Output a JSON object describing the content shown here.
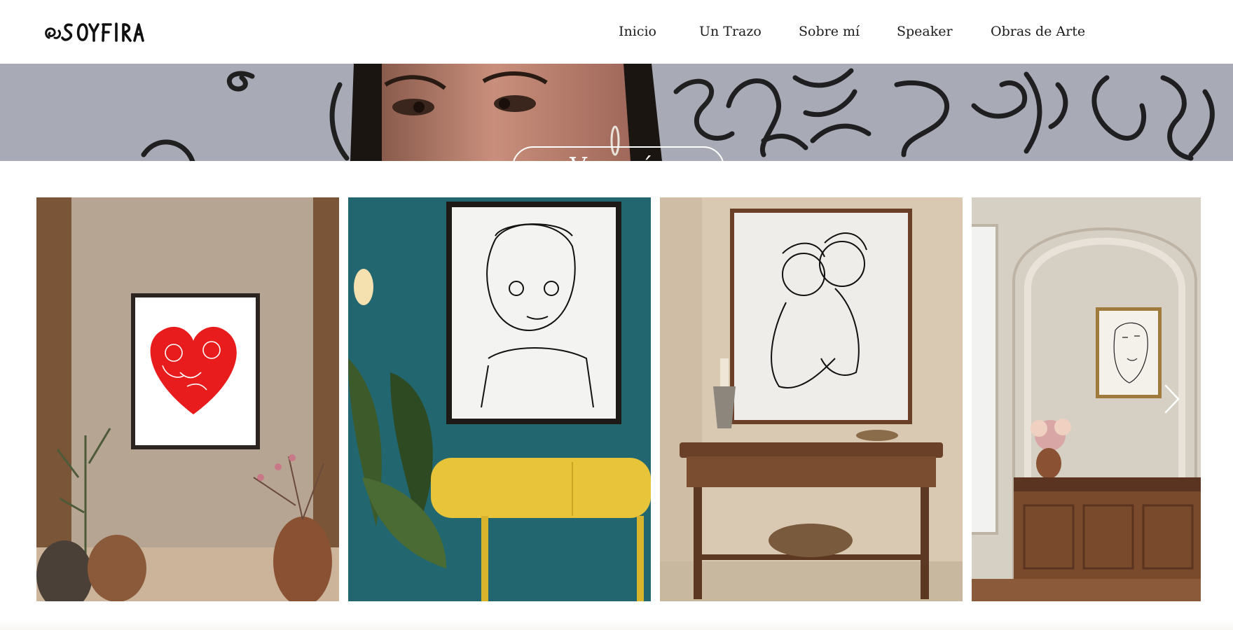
{
  "brand": {
    "logo_text": "SOYFIRA"
  },
  "nav": {
    "items": [
      {
        "label": "Inicio"
      },
      {
        "label": "Un Trazo"
      },
      {
        "label": "Sobre mí"
      },
      {
        "label": "Speaker"
      },
      {
        "label": "Obras de Arte"
      }
    ]
  },
  "hero": {
    "cta_label": "Ver más"
  },
  "gallery": {
    "items": [
      {
        "title": "heart-artwork"
      },
      {
        "title": "portrait-artwork"
      },
      {
        "title": "couple-artwork"
      },
      {
        "title": "face-artwork"
      }
    ],
    "next_icon": "chevron-right-icon"
  },
  "colors": {
    "heart_red": "#e81c1c",
    "teal_wall": "#1f5f66",
    "yellow_table": "#e8c43a",
    "beige_wall": "#d9cfc2",
    "wood": "#6a4128"
  }
}
